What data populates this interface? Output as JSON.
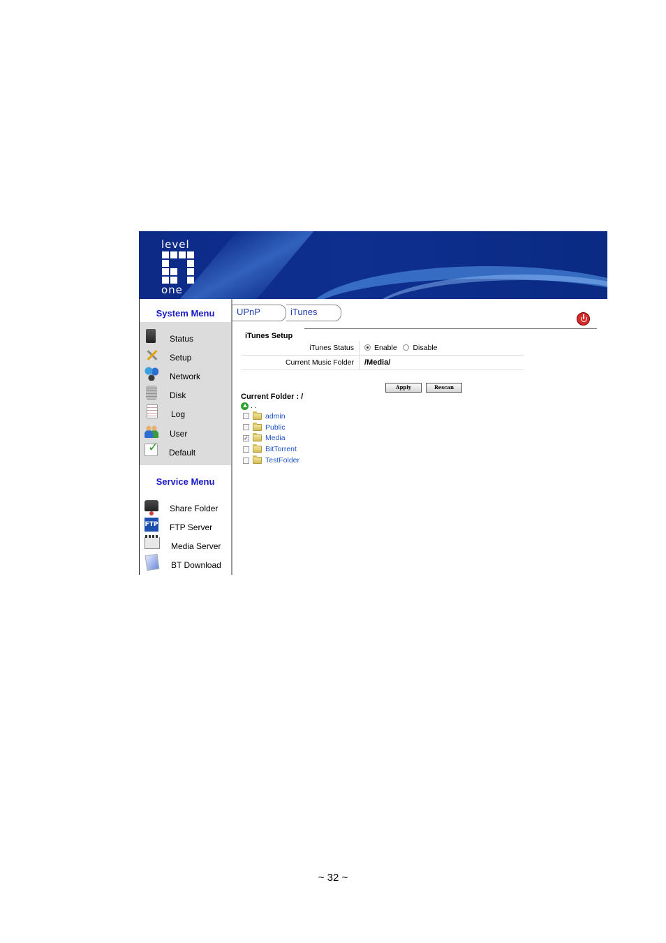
{
  "brand": {
    "logo_top": "level",
    "logo_bottom": "one"
  },
  "sidebar": {
    "system_title": "System Menu",
    "system_items": [
      {
        "label": "Status",
        "icon": "status-icon"
      },
      {
        "label": "Setup",
        "icon": "setup-icon"
      },
      {
        "label": "Network",
        "icon": "network-icon"
      },
      {
        "label": "Disk",
        "icon": "disk-icon"
      },
      {
        "label": "Log",
        "icon": "log-icon"
      },
      {
        "label": "User",
        "icon": "user-icon"
      },
      {
        "label": "Default",
        "icon": "default-icon"
      }
    ],
    "service_title": "Service Menu",
    "service_items": [
      {
        "label": "Share Folder",
        "icon": "share-folder-icon"
      },
      {
        "label": "FTP Server",
        "icon": "ftp-icon",
        "icon_text": "FTP"
      },
      {
        "label": "Media Server",
        "icon": "media-server-icon"
      },
      {
        "label": "BT Download",
        "icon": "bt-download-icon"
      }
    ]
  },
  "tabs": [
    {
      "label": "UPnP"
    },
    {
      "label": "iTunes"
    }
  ],
  "itunes": {
    "title": "iTunes Setup",
    "status_label": "iTunes Status",
    "enable_label": "Enable",
    "disable_label": "Disable",
    "status_value": "Enable",
    "folder_label": "Current Music Folder",
    "folder_value": "/Media/",
    "apply_label": "Apply",
    "rescan_label": "Rescan"
  },
  "browser": {
    "current_folder": "Current Folder : /",
    "up_label": ". .",
    "folders": [
      {
        "name": "admin",
        "checked": false
      },
      {
        "name": "Public",
        "checked": false
      },
      {
        "name": "Media",
        "checked": true
      },
      {
        "name": "BitTorrent",
        "checked": false
      },
      {
        "name": "TestFolder",
        "checked": false
      }
    ]
  },
  "page_footer": "~ 32 ~"
}
